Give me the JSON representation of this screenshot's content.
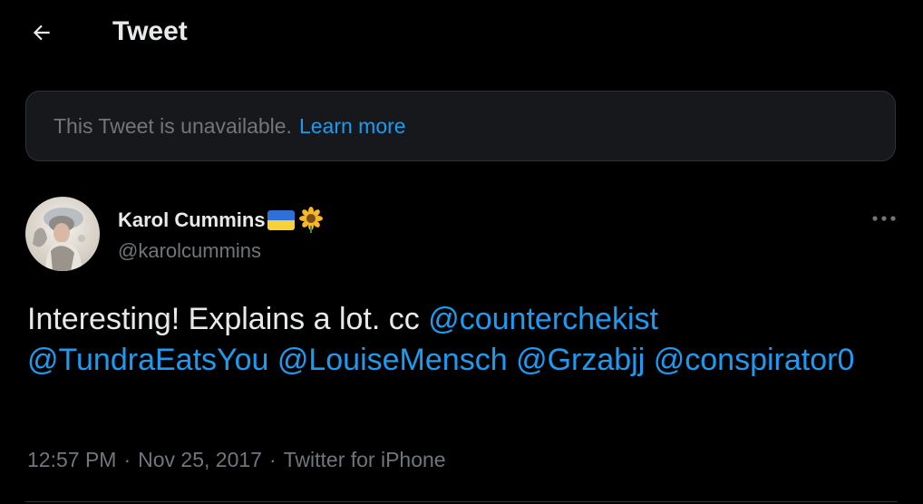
{
  "header": {
    "title": "Tweet",
    "back_icon": "arrow-left-icon"
  },
  "notice": {
    "text": "This Tweet is unavailable.",
    "link": "Learn more"
  },
  "author": {
    "name": "Karol Cummins",
    "handle": "@karolcummins",
    "badges": [
      "ukraine-flag-icon",
      "sunflower-icon"
    ]
  },
  "tweet": {
    "text_prefix": "Interesting! Explains a lot.  cc ",
    "mentions": [
      "@counterchekist",
      "@TundraEatsYou",
      "@LouiseMensch",
      "@Grzabjj",
      "@conspirator0"
    ]
  },
  "meta": {
    "time": "12:57 PM",
    "date": "Nov 25, 2017",
    "source": "Twitter for iPhone",
    "separator": "·"
  },
  "colors": {
    "background": "#000000",
    "text": "#e7e9ea",
    "muted": "#71767b",
    "accent": "#1d9bf0",
    "card": "#16181c",
    "border": "#2f3336"
  }
}
